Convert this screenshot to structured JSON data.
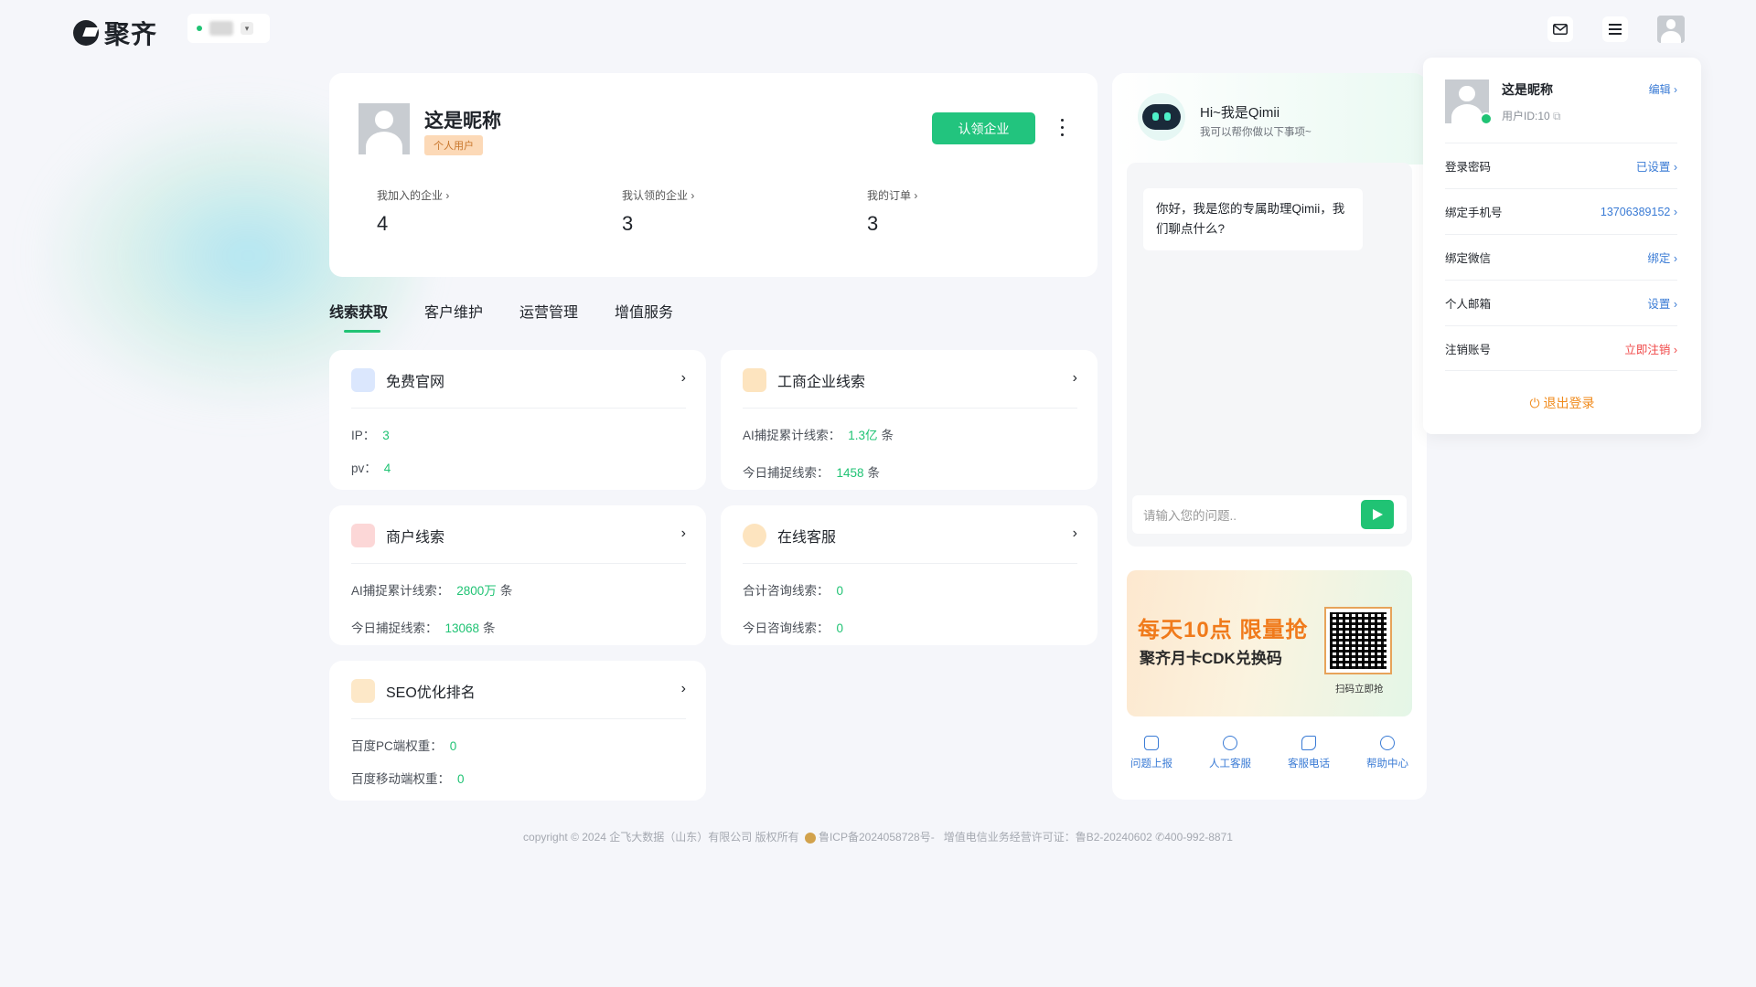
{
  "brand": {
    "name": "聚齐"
  },
  "header": {
    "mail_icon": "mail-icon",
    "menu_icon": "menu-icon"
  },
  "profile": {
    "nickname": "这是昵称",
    "badge": "个人用户",
    "claim_button": "认领企业",
    "stats": [
      {
        "label": "我加入的企业 ›",
        "value": "4"
      },
      {
        "label": "我认领的企业 ›",
        "value": "3"
      },
      {
        "label": "我的订单 ›",
        "value": "3"
      }
    ]
  },
  "tabs": [
    "线索获取",
    "客户维护",
    "运营管理",
    "增值服务"
  ],
  "services": [
    {
      "title": "免费官网",
      "rows": [
        {
          "label": "IP：",
          "value": "3",
          "unit": ""
        },
        {
          "label": "pv：",
          "value": "4",
          "unit": ""
        }
      ],
      "accent": "#5b8def"
    },
    {
      "title": "工商企业线索",
      "rows": [
        {
          "label": "AI捕捉累计线索：",
          "value": "1.3亿",
          "unit": "条"
        },
        {
          "label": "今日捕捉线索：",
          "value": "1458",
          "unit": "条"
        }
      ],
      "accent": "#f5a623"
    },
    {
      "title": "商户线索",
      "rows": [
        {
          "label": "AI捕捉累计线索：",
          "value": "2800万",
          "unit": "条"
        },
        {
          "label": "今日捕捉线索：",
          "value": "13068",
          "unit": "条"
        }
      ],
      "accent": "#f25c5c"
    },
    {
      "title": "在线客服",
      "rows": [
        {
          "label": "合计咨询线索：",
          "value": "0",
          "unit": ""
        },
        {
          "label": "今日咨询线索：",
          "value": "0",
          "unit": ""
        }
      ],
      "accent": "#f5a623"
    },
    {
      "title": "SEO优化排名",
      "rows": [
        {
          "label": "百度PC端权重：",
          "value": "0",
          "unit": ""
        },
        {
          "label": "百度移动端权重：",
          "value": "0",
          "unit": ""
        }
      ],
      "accent": "#f5a623"
    }
  ],
  "chat": {
    "title": "Hi~我是Qimii",
    "subtitle": "我可以帮你做以下事项~",
    "greeting": "你好，我是您的专属助理Qimii，我们聊点什么?",
    "input_placeholder": "请输入您的问题..",
    "banner_line1": "每天10点 限量抢",
    "banner_line2": "聚齐月卡CDK兑换码",
    "banner_caption": "扫码立即抢",
    "links": [
      "问题上报",
      "人工客服",
      "客服电话",
      "帮助中心"
    ]
  },
  "footer": {
    "copyright": "copyright © 2024 企飞大数据（山东）有限公司 版权所有",
    "icp": "鲁ICP备2024058728号-",
    "license": "增值电信业务经营许可证：鲁B2-20240602",
    "phone": "400-992-8871"
  },
  "dropdown": {
    "name": "这是昵称",
    "user_id": "用户ID:10",
    "edit": "编辑 ›",
    "rows": [
      {
        "label": "登录密码",
        "value": "已设置 ›"
      },
      {
        "label": "绑定手机号",
        "value": "13706389152 ›"
      },
      {
        "label": "绑定微信",
        "value": "绑定 ›"
      },
      {
        "label": "个人邮箱",
        "value": "设置 ›"
      },
      {
        "label": "注销账号",
        "value": "立即注销 ›"
      }
    ],
    "logout": "退出登录"
  }
}
